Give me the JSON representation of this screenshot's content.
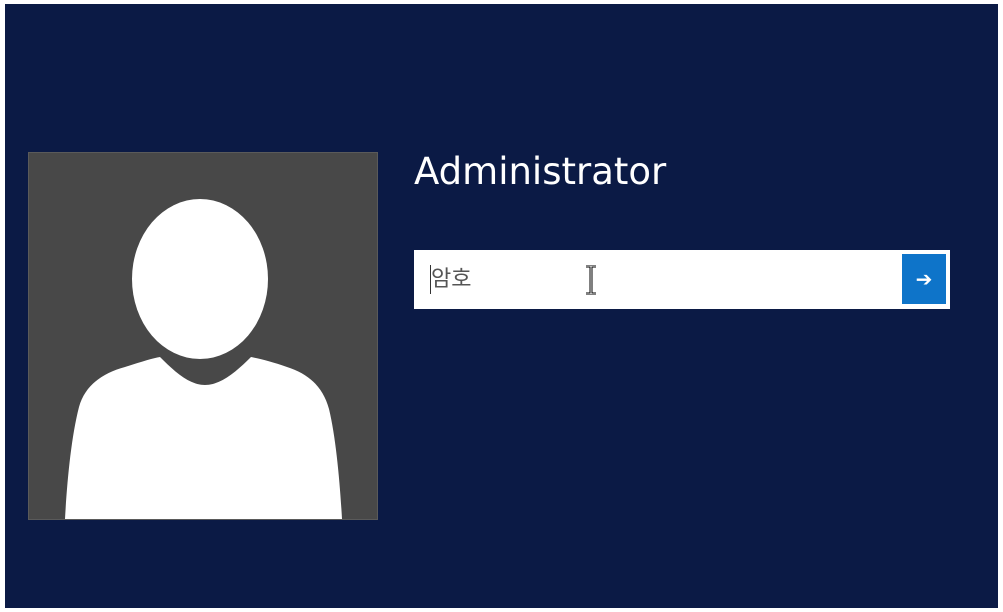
{
  "user": {
    "name": "Administrator",
    "avatar_icon": "user-silhouette-icon"
  },
  "password": {
    "placeholder": "암호",
    "value": ""
  },
  "submit": {
    "icon": "arrow-right-icon",
    "glyph": "➔"
  },
  "colors": {
    "background": "#0b1a45",
    "avatar_bg": "#484848",
    "submit_accent": "#0e74c9"
  }
}
